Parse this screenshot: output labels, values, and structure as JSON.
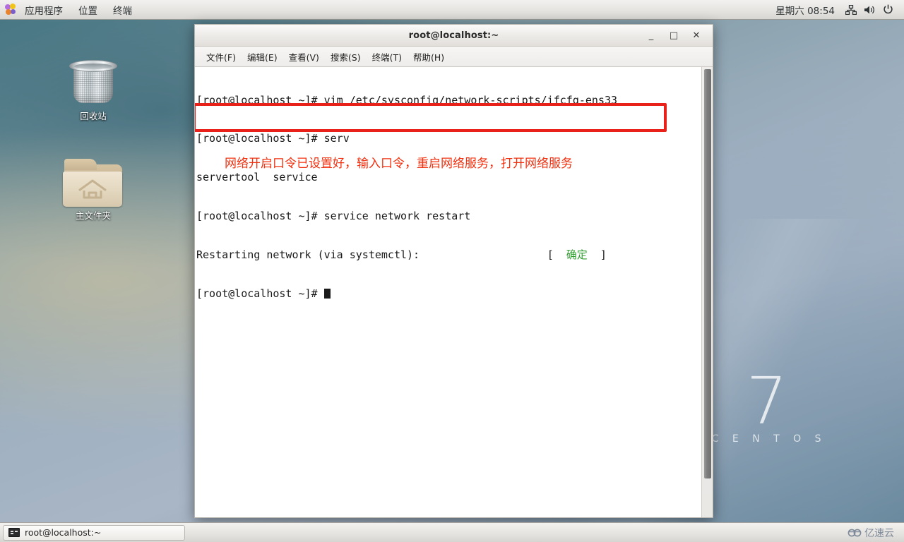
{
  "top_panel": {
    "apps_icon": "applications-icon",
    "items": [
      {
        "label": "应用程序",
        "name": "menu-applications"
      },
      {
        "label": "位置",
        "name": "menu-places"
      },
      {
        "label": "终端",
        "name": "menu-terminal"
      }
    ],
    "clock": "星期六 08:54",
    "tray": [
      {
        "name": "network-icon"
      },
      {
        "name": "volume-icon"
      },
      {
        "name": "power-icon"
      }
    ]
  },
  "desktop": {
    "icons": [
      {
        "label": "回收站",
        "name": "desktop-icon-trash"
      },
      {
        "label": "主文件夹",
        "name": "desktop-icon-home"
      }
    ],
    "brand": {
      "version": "7",
      "name": "C E N T O S"
    }
  },
  "terminal": {
    "title": "root@localhost:~",
    "window_buttons": {
      "minimize": "_",
      "maximize": "□",
      "close": "✕"
    },
    "menus": [
      {
        "label": "文件(F)"
      },
      {
        "label": "编辑(E)"
      },
      {
        "label": "查看(V)"
      },
      {
        "label": "搜索(S)"
      },
      {
        "label": "终端(T)"
      },
      {
        "label": "帮助(H)"
      }
    ],
    "lines": {
      "l1": "[root@localhost ~]# vim /etc/sysconfig/network-scripts/ifcfg-ens33",
      "l2": "[root@localhost ~]# serv",
      "l3": "servertool  service",
      "l4": "[root@localhost ~]# service network restart",
      "l5_prefix": "Restarting network (via systemctl):",
      "l5_bracket_open": "[",
      "l5_status": "确定",
      "l5_bracket_close": "]",
      "l6": "[root@localhost ~]# "
    },
    "annotation": "网络开启口令已设置好，输入口令，重启网络服务，打开网络服务",
    "colors": {
      "status_ok": "#2fa02f",
      "highlight_box": "#e8221a",
      "annotation": "#f0300f"
    }
  },
  "bottom_panel": {
    "task_button": {
      "label": "root@localhost:~",
      "icon": "terminal-icon"
    },
    "watermark": "亿速云"
  }
}
